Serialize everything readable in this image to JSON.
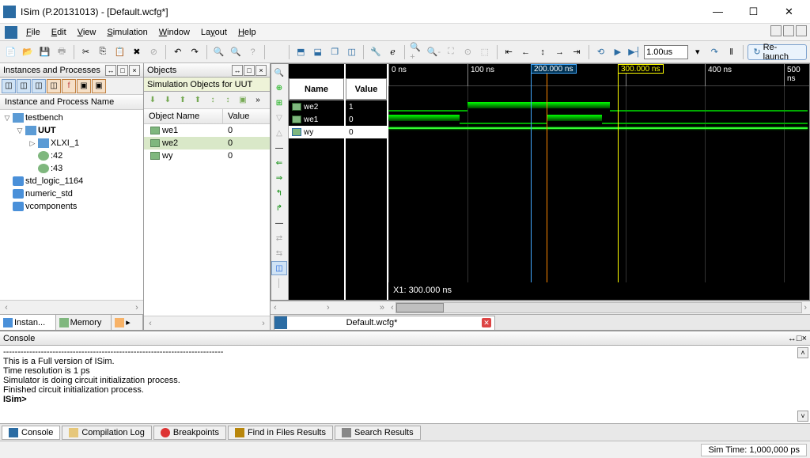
{
  "title": "ISim (P.20131013) - [Default.wcfg*]",
  "menus": {
    "file": "File",
    "edit": "Edit",
    "view": "View",
    "simulation": "Simulation",
    "window": "Window",
    "layout": "Layout",
    "help": "Help"
  },
  "toolbar": {
    "time_value": "1.00us",
    "relaunch": "Re-launch"
  },
  "instances": {
    "panel_title": "Instances and Processes",
    "col_header": "Instance and Process Name",
    "tree": [
      {
        "label": "testbench",
        "depth": 0,
        "icon": "block",
        "exp": "▽"
      },
      {
        "label": "UUT",
        "depth": 1,
        "icon": "block",
        "exp": "▽",
        "bold": true
      },
      {
        "label": "XLXI_1",
        "depth": 2,
        "icon": "block",
        "exp": "▷"
      },
      {
        "label": ":42",
        "depth": 2,
        "icon": "proc",
        "exp": ""
      },
      {
        "label": ":43",
        "depth": 2,
        "icon": "proc",
        "exp": ""
      },
      {
        "label": "std_logic_1164",
        "depth": 0,
        "icon": "pkg",
        "exp": ""
      },
      {
        "label": "numeric_std",
        "depth": 0,
        "icon": "pkg",
        "exp": ""
      },
      {
        "label": "vcomponents",
        "depth": 0,
        "icon": "pkg",
        "exp": ""
      }
    ],
    "tabs": {
      "instan": "Instan...",
      "memory": "Memory"
    }
  },
  "objects": {
    "panel_title": "Objects",
    "sub_title": "Simulation Objects for UUT",
    "cols": {
      "name": "Object Name",
      "value": "Value"
    },
    "rows": [
      {
        "name": "we1",
        "value": "0",
        "sel": false
      },
      {
        "name": "we2",
        "value": "0",
        "sel": true
      },
      {
        "name": "wy",
        "value": "0",
        "sel": false
      }
    ]
  },
  "wave": {
    "name_hdr": "Name",
    "value_hdr": "Value",
    "signals": [
      {
        "name": "we2",
        "value": "1",
        "sel": false
      },
      {
        "name": "we1",
        "value": "0",
        "sel": false
      },
      {
        "name": "wy",
        "value": "0",
        "sel": true
      }
    ],
    "ticks": [
      "0 ns",
      "100 ns",
      "200 ns",
      "300 ns",
      "400 ns",
      "500 ns"
    ],
    "marker_blue": "200.000 ns",
    "marker_yellow": "300.000 ns",
    "status": "X1: 300.000 ns",
    "tab": "Default.wcfg*"
  },
  "console": {
    "panel_title": "Console",
    "lines": [
      "----------------------------------------------------------------------------",
      "This is a Full version of ISim.",
      "Time resolution is 1 ps",
      "Simulator is doing circuit initialization process.",
      "Finished circuit initialization process."
    ],
    "prompt": "ISim>",
    "tabs": {
      "console": "Console",
      "comp": "Compilation Log",
      "bp": "Breakpoints",
      "find": "Find in Files Results",
      "search": "Search Results"
    }
  },
  "status": {
    "sim_time": "Sim Time: 1,000,000 ps"
  }
}
